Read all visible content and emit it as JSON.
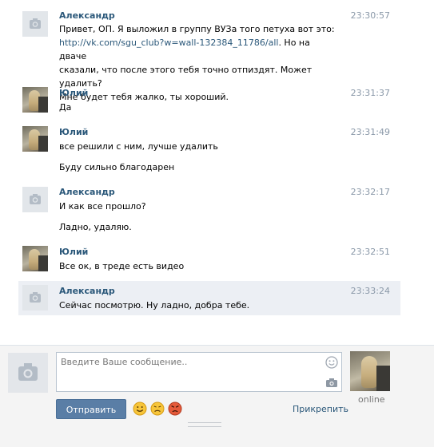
{
  "messages": [
    {
      "author": "Александр",
      "avatar": "camera-placeholder",
      "time": "23:30:57",
      "lines": [
        "Привет, ОП. Я выложил в группу ВУЗа того петуха вот это:",
        "сказали, что после этого тебя точно отпиздят. Может удалить?",
        "Мне будет тебя жалко, ты хороший."
      ],
      "link": "http://vk.com/sgu_club?w=wall-132384_11786/all",
      "link_suffix": ". Но на дваче"
    },
    {
      "author": "Юлий",
      "avatar": "user-photo",
      "time": "23:31:37",
      "lines": [
        "Да"
      ]
    },
    {
      "author": "Юлий",
      "avatar": "user-photo",
      "time": "23:31:49",
      "lines": [
        "все решили с ним, лучше удалить"
      ],
      "extra": "Буду сильно благодарен"
    },
    {
      "author": "Александр",
      "avatar": "camera-placeholder",
      "time": "23:32:17",
      "lines": [
        "И как все прошло?"
      ],
      "extra": "Ладно, удаляю."
    },
    {
      "author": "Юлий",
      "avatar": "user-photo",
      "time": "23:32:51",
      "lines": [
        "Все ок, в треде есть видео"
      ]
    },
    {
      "author": "Александр",
      "avatar": "camera-placeholder",
      "time": "23:33:24",
      "lines": [
        "Сейчас посмотрю. Ну ладно, добра тебе."
      ],
      "highlighted": true
    }
  ],
  "composer": {
    "placeholder": "Введите Ваше сообщение..",
    "send_label": "Отправить",
    "attach_label": "Прикрепить",
    "status": "online",
    "emoji": [
      "smile",
      "worried",
      "angry"
    ]
  },
  "colors": {
    "accent": "#2b587a",
    "button": "#5a7ea6",
    "highlight": "#eceff4",
    "time": "#8a98a8"
  }
}
